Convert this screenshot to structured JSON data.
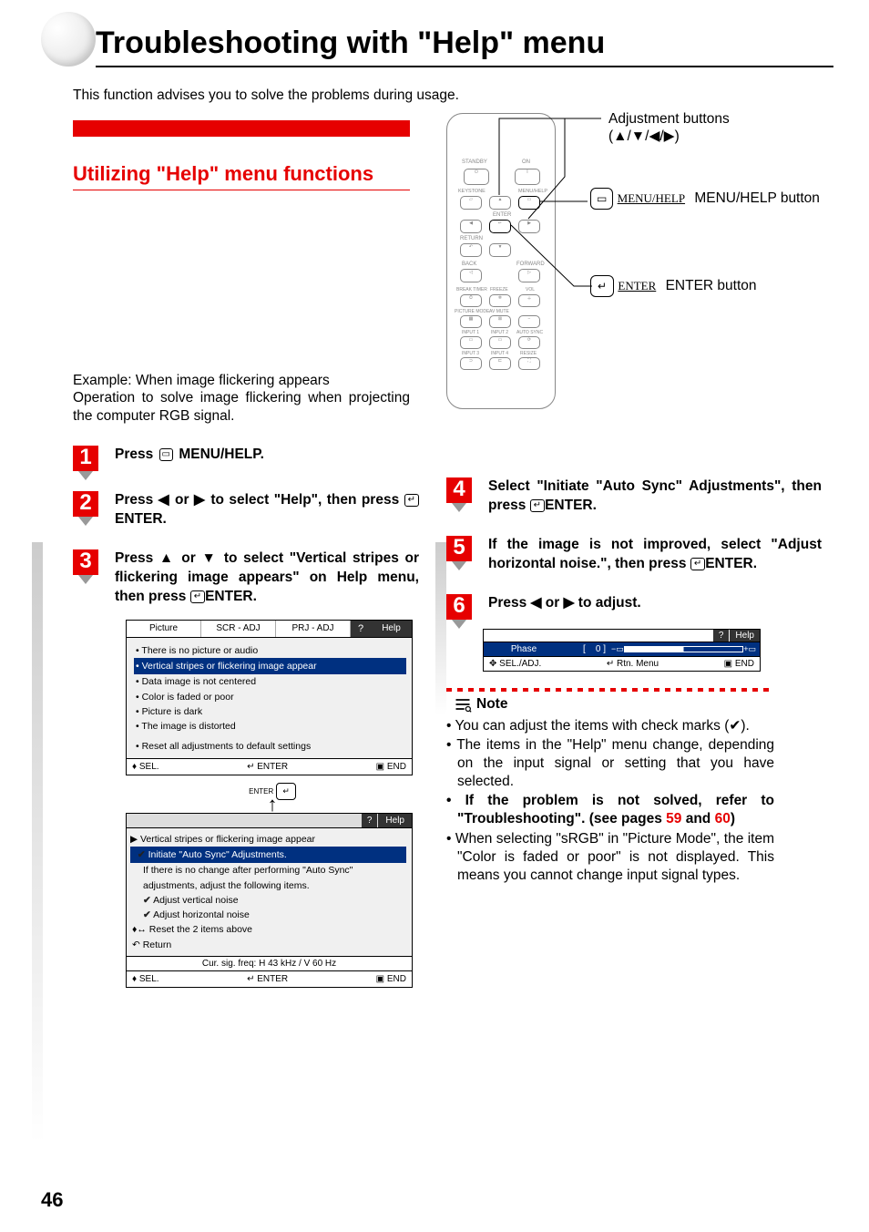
{
  "page_number": "46",
  "title": "Troubleshooting with \"Help\" menu",
  "intro": "This function advises you to solve the problems during usage.",
  "section_title": "Utilizing \"Help\" menu functions",
  "example": {
    "head": "Example: When image flickering appears",
    "body": "Operation to solve image flickering when projecting the computer RGB signal."
  },
  "steps": [
    {
      "n": "1",
      "text_pre": "Press ",
      "key": "MENU/HELP",
      "text_post": "."
    },
    {
      "n": "2",
      "text": "Press ◀ or ▶ to select \"Help\", then press ",
      "key": "ENTER",
      "tail": "."
    },
    {
      "n": "3",
      "text": "Press ▲ or ▼ to select \"Vertical stripes or flickering image appears\" on Help menu, then press ",
      "key": "ENTER",
      "tail": "."
    },
    {
      "n": "4",
      "text": "Select \"Initiate \"Auto Sync\" Adjustments\", then press ",
      "key": "ENTER",
      "tail": "."
    },
    {
      "n": "5",
      "text": "If the image is not improved, select \"Adjust horizontal noise.\", then press ",
      "key": "ENTER",
      "tail": "."
    },
    {
      "n": "6",
      "text": "Press ◀ or ▶ to adjust."
    }
  ],
  "osd1": {
    "tabs": [
      "Picture",
      "SCR - ADJ",
      "PRJ - ADJ"
    ],
    "help_tab": "Help",
    "items": [
      "There is no picture or audio",
      "Vertical stripes or flickering image appear",
      "Data image is not centered",
      "Color is faded or poor",
      "Picture is dark",
      "The image is distorted",
      "Reset all adjustments to default settings"
    ],
    "selected_index": 1,
    "foot": {
      "sel": "SEL.",
      "enter": "ENTER",
      "end": "END"
    }
  },
  "osd_sep_label": "ENTER",
  "osd2": {
    "help_tab": "Help",
    "header": "Vertical stripes or flickering image appear",
    "items": [
      "Initiate \"Auto Sync\" Adjustments.",
      "If there is no change after performing \"Auto Sync\" adjustments, adjust the following items.",
      "Adjust vertical noise",
      "Adjust horizontal noise",
      "Reset the 2 items above",
      "Return"
    ],
    "checks": [
      0,
      2,
      3
    ],
    "selected_index": 0,
    "sig": "Cur. sig. freq: H 43 kHz / V 60 Hz",
    "foot": {
      "sel": "SEL.",
      "enter": "ENTER",
      "end": "END"
    }
  },
  "osd3": {
    "help_tab": "Help",
    "label": "Phase",
    "value": "0",
    "foot": {
      "sel": "SEL./ADJ.",
      "rtn": "Rtn. Menu",
      "end": "END"
    }
  },
  "remote": {
    "adj_label": "Adjustment buttons",
    "adj_sub": "(▲/▼/◀/▶)",
    "menu_key": "MENU/HELP",
    "menu_label": "MENU/HELP button",
    "enter_key": "ENTER",
    "enter_label": "ENTER button",
    "btn_labels": {
      "standby": "STANDBY",
      "on": "ON",
      "keystone": "KEYSTONE",
      "menuhelp": "MENU/HELP",
      "enter": "ENTER",
      "return": "RETURN",
      "back": "BACK",
      "forward": "FORWARD",
      "breaktimer": "BREAK TIMER",
      "freeze": "FREEZE",
      "vol": "VOL",
      "pmode": "PICTURE MODE",
      "avmute": "AV MUTE",
      "in1": "INPUT 1",
      "in2": "INPUT 2",
      "autosync": "AUTO SYNC",
      "in3": "INPUT 3",
      "in4": "INPUT 4",
      "resize": "RESIZE"
    }
  },
  "note": {
    "title": "Note",
    "items": [
      {
        "text": "You can adjust the items with check marks (✔).",
        "bold": false
      },
      {
        "text": "The items in the \"Help\" menu change, depending on the input signal or setting that you have selected.",
        "bold": false
      },
      {
        "text": "If the problem is not solved, refer to \"Troubleshooting\". (see pages 59 and 60)",
        "bold": true,
        "red_suffix": "59 and 60)"
      },
      {
        "text": "When selecting \"sRGB\" in \"Picture Mode\", the item \"Color is faded or poor\" is not displayed. This means you cannot change input signal types.",
        "bold": false
      }
    ]
  }
}
